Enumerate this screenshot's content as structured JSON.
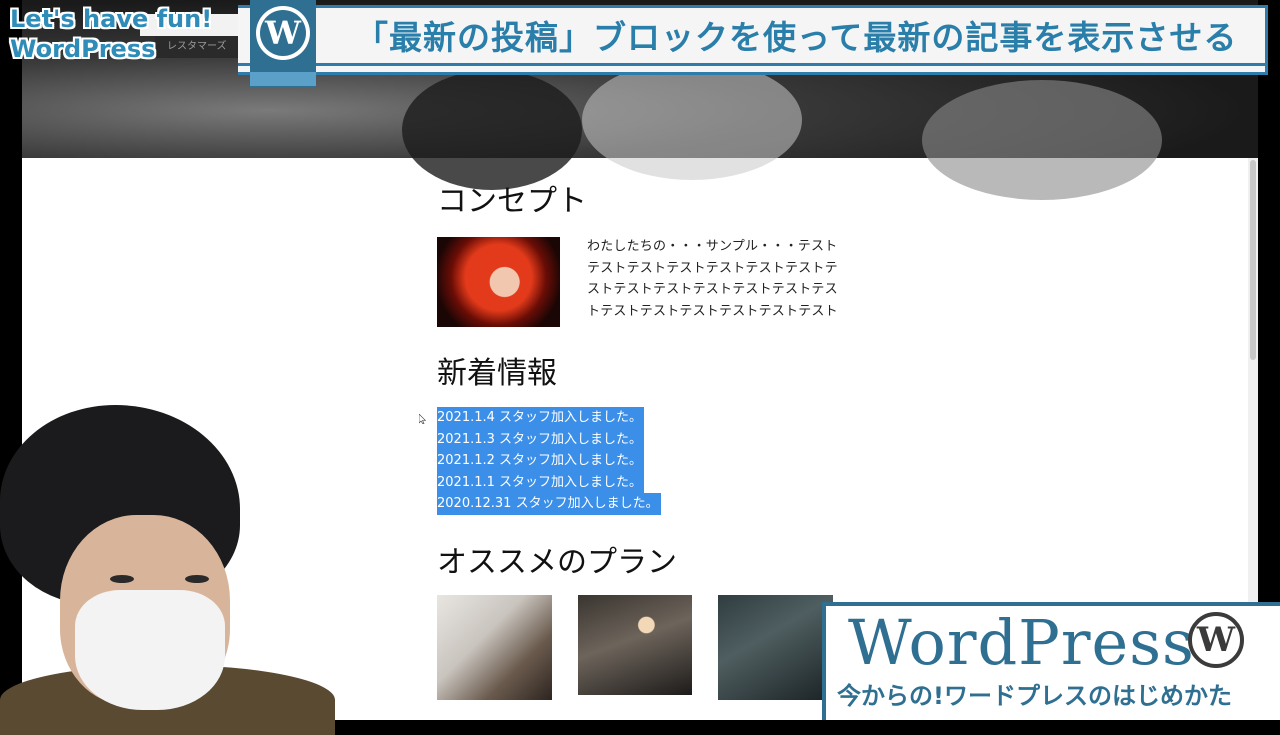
{
  "overlay": {
    "brand_line1": "Let's have fun!",
    "brand_line2": "WordPress",
    "episode_title": "「最新の投稿」ブロックを使って最新の記事を表示させる",
    "wp_badge_glyph": "W",
    "logo_wordmark": "WordPress",
    "logo_glyph": "W",
    "logo_tagline": "今からの!ワードプレスのはじめかた",
    "topbar_label": "レスタマーズ"
  },
  "page": {
    "concept_heading": "コンセプト",
    "concept_body": "わたしたちの・・・サンプル・・・テストテストテストテストテストテストテストテストテストテストテストテストテストテストテストテストテストテストテストテスト",
    "news_heading": "新着情報",
    "news_items": [
      "2021.1.4 スタッフ加入しました。",
      "2021.1.3 スタッフ加入しました。",
      "2021.1.2 スタッフ加入しました。",
      "2021.1.1 スタッフ加入しました。",
      "2020.12.31 スタッフ加入しました。"
    ],
    "plan_heading": "オススメのプラン"
  },
  "colors": {
    "brand_blue": "#2f7bab",
    "selection_blue": "#3b8fe8",
    "wp_dark": "#2f6f92"
  }
}
